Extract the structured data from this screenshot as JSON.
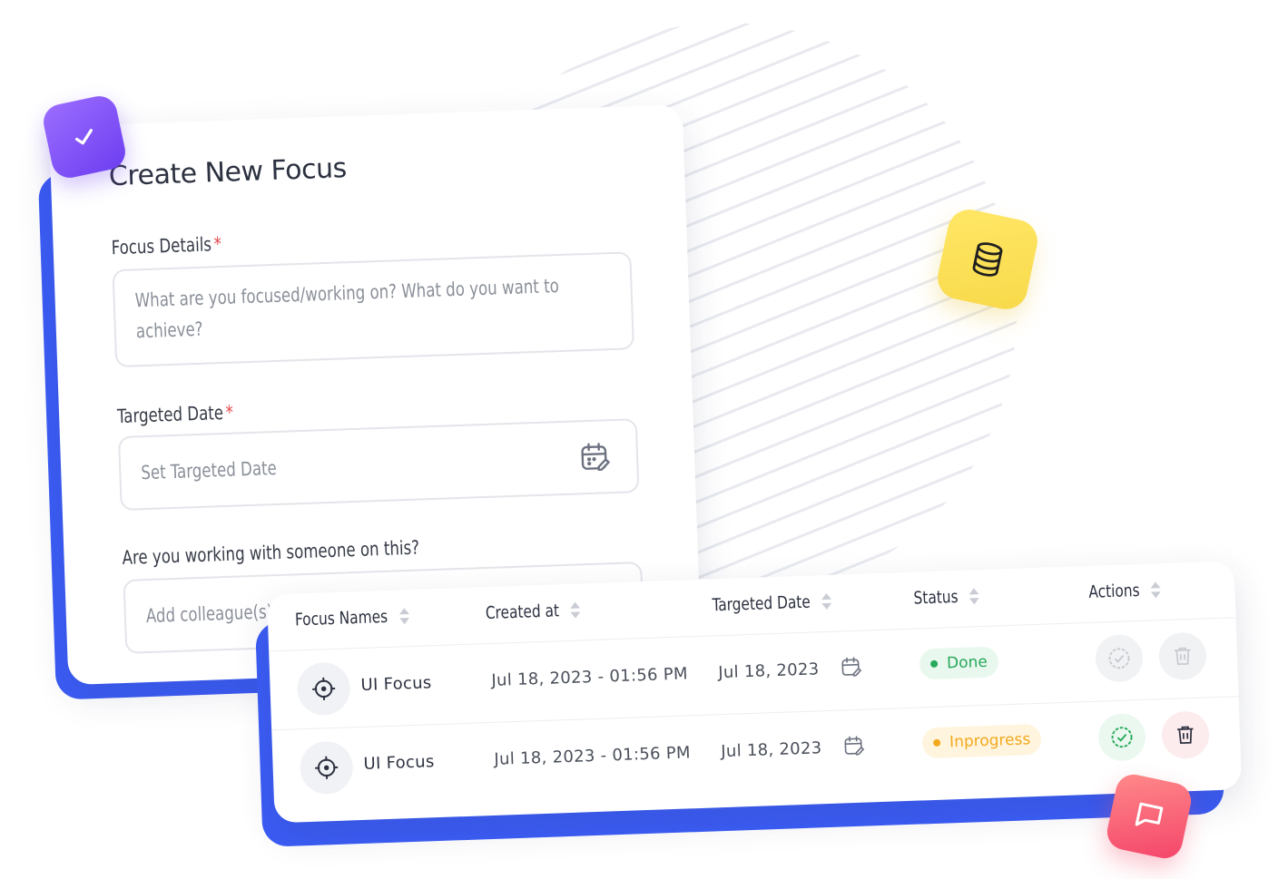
{
  "form": {
    "title": "Create New Focus",
    "focus_details": {
      "label": "Focus Details",
      "required_mark": "*",
      "placeholder": "What are you focused/working on? What do you want to achieve?"
    },
    "targeted_date": {
      "label": "Targeted Date",
      "required_mark": "*",
      "placeholder": "Set Targeted Date"
    },
    "colleagues": {
      "label": "Are you working with someone on this?",
      "placeholder": "Add colleague(s)"
    }
  },
  "table": {
    "headers": [
      "Focus Names",
      "Created at",
      "Targeted Date",
      "Status",
      "Actions"
    ],
    "rows": [
      {
        "name": "UI Focus",
        "created_at": "Jul 18, 2023 - 01:56 PM",
        "targeted_date": "Jul 18, 2023",
        "status": "Done"
      },
      {
        "name": "UI Focus",
        "created_at": "Jul 18, 2023 - 01:56 PM",
        "targeted_date": "Jul 18, 2023",
        "status": "Inprogress"
      }
    ]
  },
  "icons": {
    "check_badge": "check-icon",
    "db_badge": "database-icon",
    "chat_badge": "chat-icon",
    "calendar": "calendar-edit-icon",
    "target": "crosshair-icon",
    "sort": "sort-icon",
    "approve": "check-circle-icon",
    "delete": "trash-icon"
  },
  "colors": {
    "accent_blue": "#3b5cf5",
    "purple_badge": "#7c4dff",
    "yellow_badge": "#fbe05a",
    "red_badge": "#f4456a",
    "done_green": "#27a85a",
    "progress_orange": "#f2a91e",
    "required_red": "#e5484d"
  }
}
